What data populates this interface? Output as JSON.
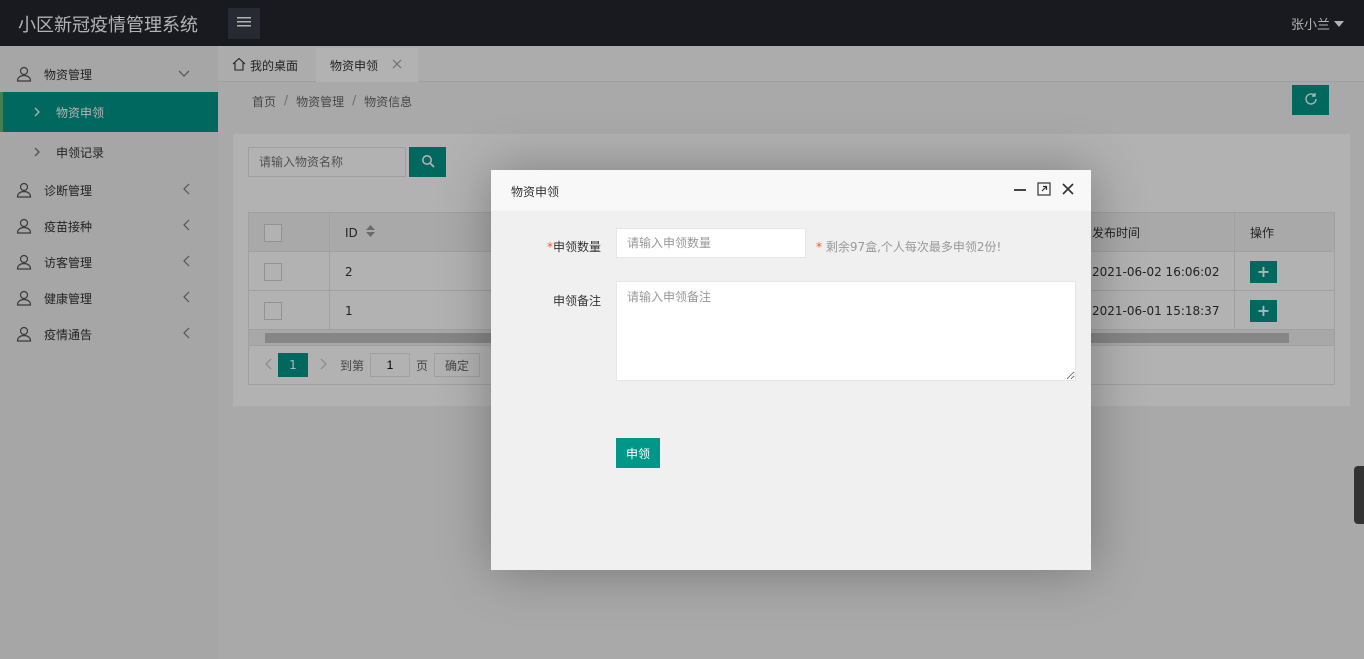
{
  "app": {
    "title": "小区新冠疫情管理系统",
    "user": "张小兰"
  },
  "sidebar": {
    "groups": [
      {
        "label": "物资管理",
        "expanded": true,
        "children": [
          {
            "label": "物资申领",
            "active": true
          },
          {
            "label": "申领记录",
            "active": false
          }
        ]
      },
      {
        "label": "诊断管理"
      },
      {
        "label": "疫苗接种"
      },
      {
        "label": "访客管理"
      },
      {
        "label": "健康管理"
      },
      {
        "label": "疫情通告"
      }
    ]
  },
  "tabs": [
    {
      "label": "我的桌面",
      "icon": "home-icon"
    },
    {
      "label": "物资申领",
      "active": true
    }
  ],
  "breadcrumb": [
    "首页",
    "物资管理",
    "物资信息"
  ],
  "search": {
    "placeholder": "请输入物资名称"
  },
  "table": {
    "headers": {
      "id": "ID",
      "time": "发布时间",
      "op": "操作"
    },
    "rows": [
      {
        "id": "2",
        "time": "2021-06-02 16:06:02"
      },
      {
        "id": "1",
        "time": "2021-06-01 15:18:37"
      }
    ]
  },
  "pager": {
    "current": "1",
    "goto_label": "到第",
    "goto_value": "1",
    "page_unit": "页",
    "confirm": "确定"
  },
  "modal": {
    "title": "物资申领",
    "quantity_label": "申领数量",
    "quantity_placeholder": "请输入申领数量",
    "hint": "剩余97盒,个人每次最多申领2份!",
    "remark_label": "申领备注",
    "remark_placeholder": "请输入申领备注",
    "submit": "申领"
  },
  "colors": {
    "accent": "#009688",
    "header_bg": "#23262e"
  }
}
